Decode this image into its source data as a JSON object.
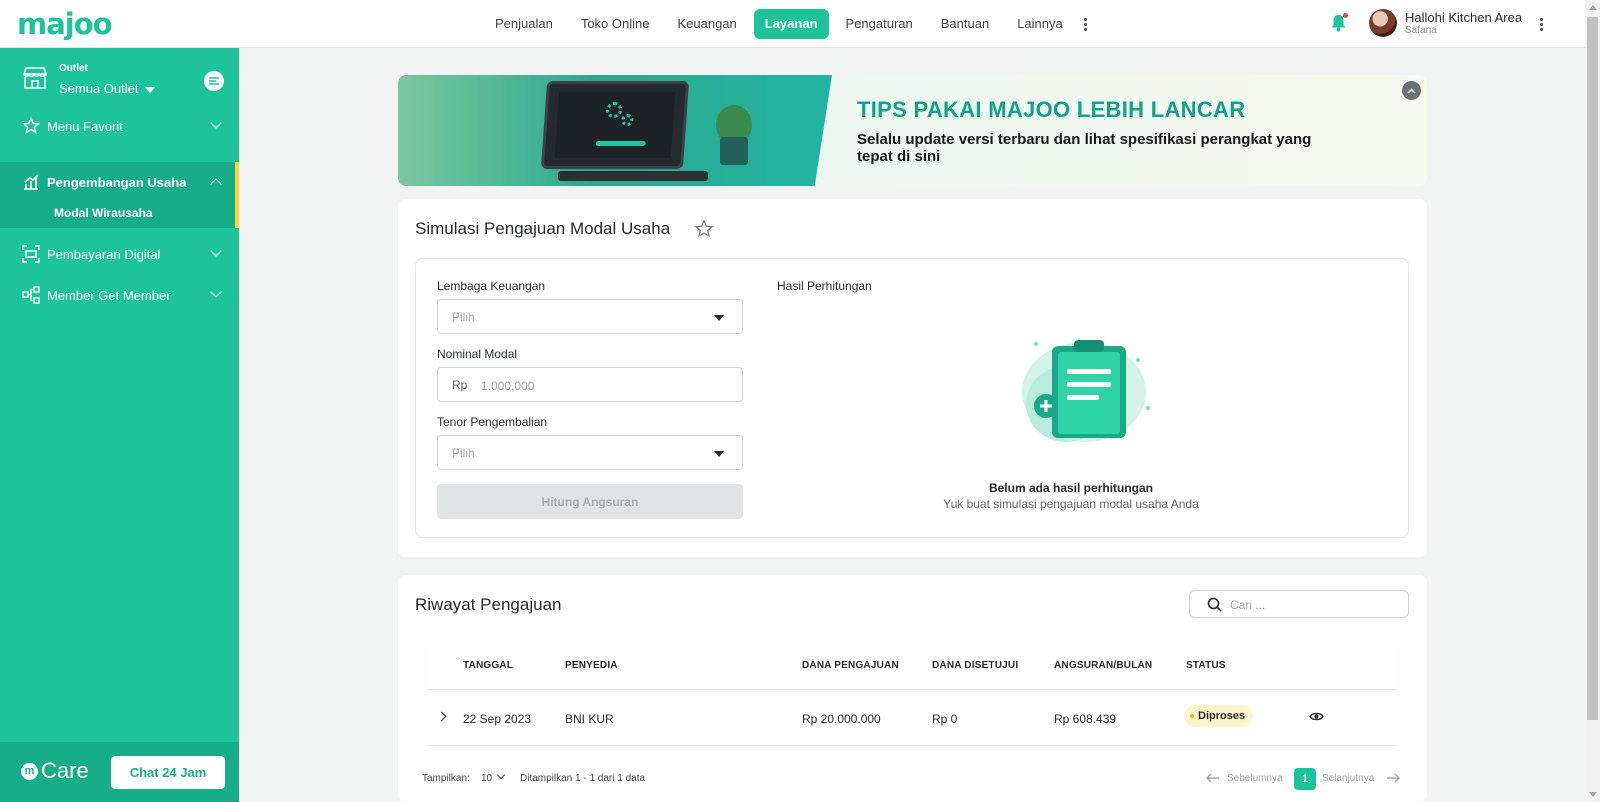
{
  "brand": {
    "logo": "majoo",
    "accent": "#1dc49b"
  },
  "topnav": {
    "items": [
      {
        "label": "Penjualan",
        "active": false
      },
      {
        "label": "Toko Online",
        "active": false
      },
      {
        "label": "Keuangan",
        "active": false
      },
      {
        "label": "Layanan",
        "active": true
      },
      {
        "label": "Pengaturan",
        "active": false
      },
      {
        "label": "Bantuan",
        "active": false
      },
      {
        "label": "Lainnya",
        "active": false
      }
    ]
  },
  "user": {
    "name": "Hallohi Kitchen Area",
    "sub": "Safana"
  },
  "sidebar": {
    "outlet_label": "Outlet",
    "outlet_value": "Semua Outlet",
    "items": [
      {
        "label": "Menu Favorit",
        "icon": "star-icon"
      },
      {
        "label": "Pengembangan Usaha",
        "icon": "growth-icon"
      },
      {
        "label": "Pembayaran Digital",
        "icon": "scan-icon"
      },
      {
        "label": "Member Get Member",
        "icon": "network-icon"
      }
    ],
    "submenu_active": "Modal Wirausaha",
    "care_label": "Care",
    "chat_button": "Chat 24 Jam"
  },
  "banner": {
    "title": "TIPS PAKAI MAJOO LEBIH LANCAR",
    "text": "Selalu update versi terbaru dan lihat spesifikasi perangkat yang tepat di sini"
  },
  "simulasi": {
    "title": "Simulasi Pengajuan Modal Usaha",
    "lembaga_label": "Lembaga Keuangan",
    "lembaga_placeholder": "Pilih",
    "nominal_label": "Nominal Modal",
    "nominal_prefix": "Rp",
    "nominal_placeholder": "1.000.000",
    "tenor_label": "Tenor Pengembalian",
    "tenor_placeholder": "Pilih",
    "button": "Hitung Angsuran",
    "result_label": "Hasil Perhitungan",
    "empty_title": "Belum ada hasil perhitungan",
    "empty_sub": "Yuk buat simulasi pengajuan modal usaha Anda"
  },
  "riwayat": {
    "title": "Riwayat Pengajuan",
    "search_placeholder": "Cari ...",
    "columns": [
      "TANGGAL",
      "PENYEDIA",
      "DANA PENGAJUAN",
      "DANA DISETUJUI",
      "ANGSURAN/BULAN",
      "STATUS"
    ],
    "rows": [
      {
        "tanggal": "22 Sep 2023",
        "penyedia": "BNI KUR",
        "dana_pengajuan": "Rp 20.000.000",
        "dana_disetujui": "Rp 0",
        "angsuran": "Rp 608.439",
        "status": "Diproses"
      }
    ],
    "footer": {
      "tampilkan_label": "Tampilkan:",
      "page_size": "10",
      "summary": "Ditampilkan 1 - 1 dari 1 data",
      "prev": "Sebelumnya",
      "page": "1",
      "next": "Selanjutnya"
    }
  }
}
